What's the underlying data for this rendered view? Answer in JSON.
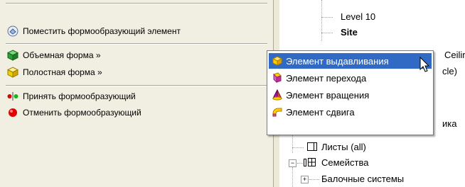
{
  "left_panel": {
    "place_form": "Поместить формообразующий элемент",
    "solid_form": "Объемная форма »",
    "void_form": "Полостная форма »",
    "finish_form": "Принять формообразующий",
    "cancel_form": "Отменить формообразующий"
  },
  "submenu": {
    "items": [
      {
        "label": "Элемент выдавливания",
        "icon": "extrusion-icon",
        "highlighted": true
      },
      {
        "label": "Элемент перехода",
        "icon": "blend-icon"
      },
      {
        "label": "Элемент вращения",
        "icon": "revolve-icon"
      },
      {
        "label": "Элемент сдвига",
        "icon": "sweep-icon"
      }
    ]
  },
  "tree": {
    "level": "Level 10",
    "site": "Site",
    "partial_ceil": "Ceilir",
    "partial_cle": "cle)",
    "partial_ika": "ика",
    "sheets": "Листы (all)",
    "families": "Семейства",
    "beam_systems": "Балочные системы"
  },
  "colors": {
    "highlight": "#316ac5",
    "panel": "#f1efe2",
    "cube_green": "#2e9d3e",
    "cube_yellow": "#f0d000",
    "cancel_red": "#e00000"
  }
}
